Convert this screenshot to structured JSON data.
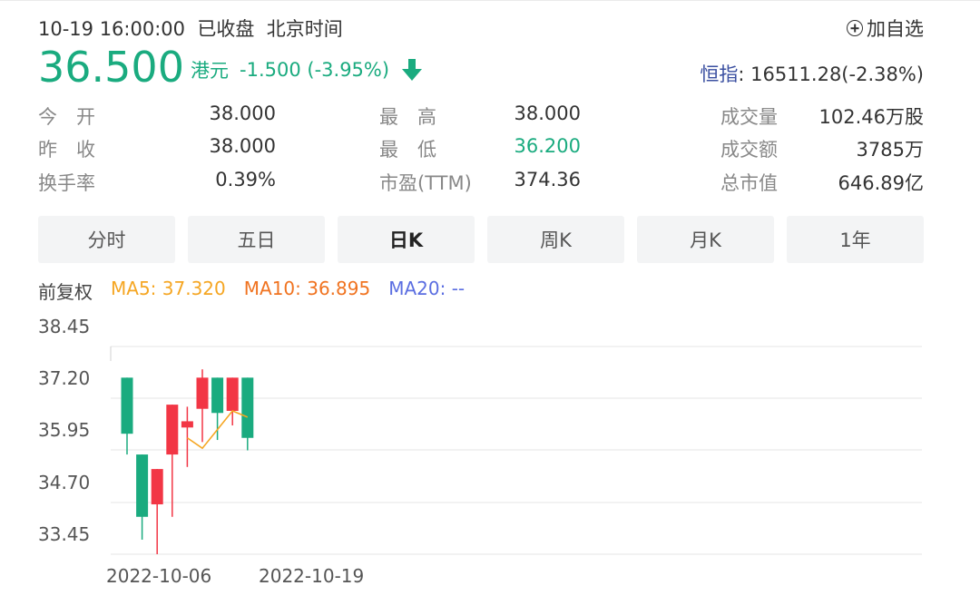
{
  "header": {
    "datetime": "10-19 16:00:00",
    "status": "已收盘",
    "timezone": "北京时间",
    "watch_label": "加自选"
  },
  "quote": {
    "price": "36.500",
    "currency": "港元",
    "change": "-1.500",
    "change_pct": "(-3.95%)",
    "direction_icon": "down-arrow-icon",
    "index_name": "恒指",
    "index_value": ": 16511.28(-2.38%)"
  },
  "stats": [
    {
      "label": "今　开",
      "value": "38.000"
    },
    {
      "label": "昨　收",
      "value": "38.000"
    },
    {
      "label": "换手率",
      "value": "0.39%"
    },
    {
      "label": "最　高",
      "value": "38.000"
    },
    {
      "label": "最　低",
      "value": "36.200"
    },
    {
      "label": "市盈(TTM)",
      "value": "374.36"
    },
    {
      "label": "成交量",
      "value": "102.46万股"
    },
    {
      "label": "成交额",
      "value": "3785万"
    },
    {
      "label": "总市值",
      "value": "646.89亿"
    }
  ],
  "tabs": [
    "分时",
    "五日",
    "日K",
    "周K",
    "月K",
    "1年"
  ],
  "active_tab": "日K",
  "indicators": {
    "adjust": "前复权",
    "ma5": "MA5: 37.320",
    "ma10": "MA10: 36.895",
    "ma20": "MA20: --"
  },
  "colors": {
    "up": "#f23645",
    "down": "#1aab7f",
    "ma5": "#f5a623",
    "ma10": "#f07320",
    "ma20": "#5b6ee1",
    "index_name": "#3a4fa0"
  },
  "chart_data": {
    "type": "candlestick",
    "y_ticks": [
      "38.45",
      "37.20",
      "35.95",
      "34.70",
      "33.45"
    ],
    "ylim": [
      33.45,
      38.45
    ],
    "x_tick_labels": [
      "2022-10-06",
      "2022-10-19"
    ],
    "grid": true,
    "candles": [
      {
        "open": 37.7,
        "close": 36.35,
        "high": 37.7,
        "low": 35.85,
        "color": "down"
      },
      {
        "open": 35.85,
        "close": 34.35,
        "high": 35.85,
        "low": 33.8,
        "color": "down"
      },
      {
        "open": 34.65,
        "close": 35.5,
        "high": 35.5,
        "low": 33.45,
        "color": "up"
      },
      {
        "open": 35.85,
        "close": 37.05,
        "high": 37.05,
        "low": 34.35,
        "color": "up"
      },
      {
        "open": 36.5,
        "close": 36.65,
        "high": 37.0,
        "low": 35.55,
        "color": "up"
      },
      {
        "open": 36.95,
        "close": 37.7,
        "high": 37.9,
        "low": 36.15,
        "color": "up"
      },
      {
        "open": 37.7,
        "close": 36.85,
        "high": 37.7,
        "low": 36.2,
        "color": "down"
      },
      {
        "open": 36.9,
        "close": 37.7,
        "high": 37.7,
        "low": 36.55,
        "color": "up"
      },
      {
        "open": 37.7,
        "close": 36.25,
        "high": 37.7,
        "low": 35.95,
        "color": "down"
      }
    ],
    "ma5_line": [
      null,
      null,
      null,
      null,
      36.25,
      36.0,
      36.45,
      36.9,
      36.75
    ]
  }
}
